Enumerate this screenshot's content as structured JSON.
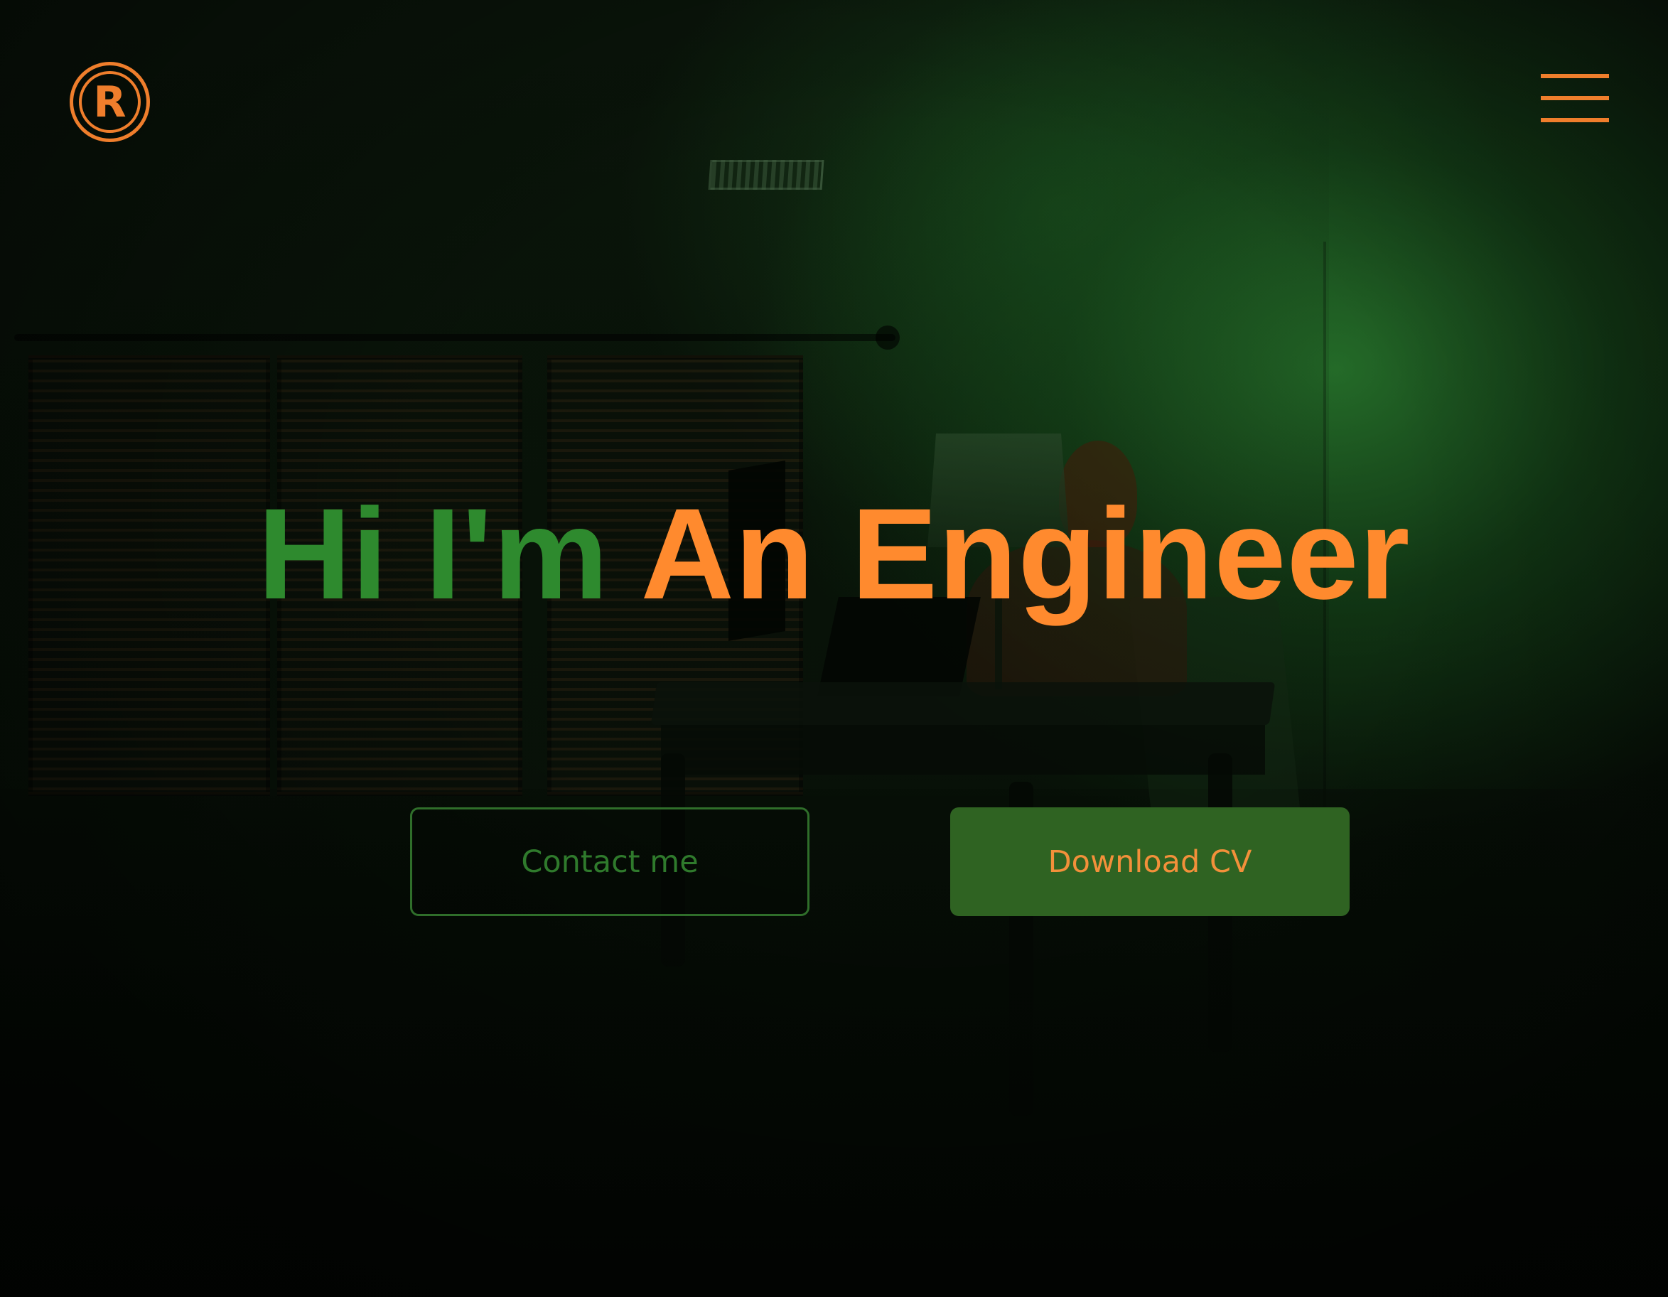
{
  "header": {
    "logo_letter": "R",
    "logo_icon": "registered-r-icon",
    "menu_icon": "hamburger-menu-icon"
  },
  "hero": {
    "greeting": "Hi I'm",
    "role": "An Engineer",
    "buttons": {
      "contact_label": "Contact me",
      "download_label": "Download CV"
    }
  },
  "colors": {
    "accent_orange": "#ef7e2c",
    "accent_green": "#2e8a2e",
    "button_green": "#2f6322",
    "background": "#0a150a"
  }
}
